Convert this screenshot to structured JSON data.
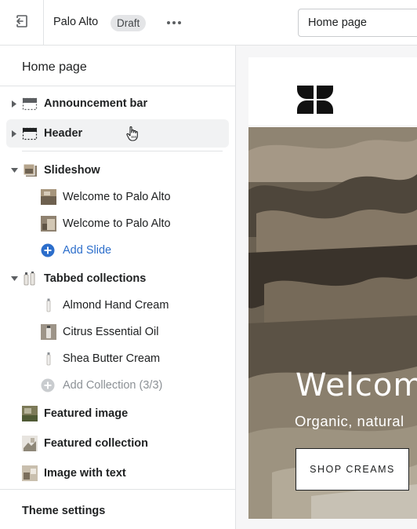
{
  "topbar": {
    "exit_icon": "exit-icon",
    "theme_name": "Palo Alto",
    "status_badge": "Draft",
    "more_icon": "more-horizontal-icon",
    "page_select_value": "Home page"
  },
  "sidebar": {
    "title": "Home page",
    "sections": [
      {
        "label": "Announcement bar",
        "icon": "announcement-bar-icon"
      },
      {
        "label": "Header",
        "icon": "header-icon"
      },
      {
        "label": "Slideshow",
        "icon": "slideshow-icon",
        "children": [
          "Welcome to Palo Alto",
          "Welcome to Palo Alto"
        ],
        "add_label": "Add Slide"
      },
      {
        "label": "Tabbed collections",
        "icon": "tabbed-collections-icon",
        "children": [
          "Almond Hand Cream",
          "Citrus Essential Oil",
          "Shea Butter Cream"
        ],
        "add_label": "Add Collection (3/3)"
      },
      {
        "label": "Featured image",
        "icon": "featured-image-icon"
      },
      {
        "label": "Featured collection",
        "icon": "featured-collection-icon"
      },
      {
        "label": "Image with text",
        "icon": "image-with-text-icon"
      }
    ],
    "theme_settings": "Theme settings"
  },
  "preview": {
    "logo_icon": "store-logo-icon",
    "hero_heading": "Welcome",
    "hero_subheading": "Organic, natural",
    "hero_button": "SHOP CREAMS"
  },
  "colors": {
    "accent": "#2c6ecb",
    "badge_bg": "#e4e5e7",
    "hover_bg": "#f1f2f3"
  }
}
